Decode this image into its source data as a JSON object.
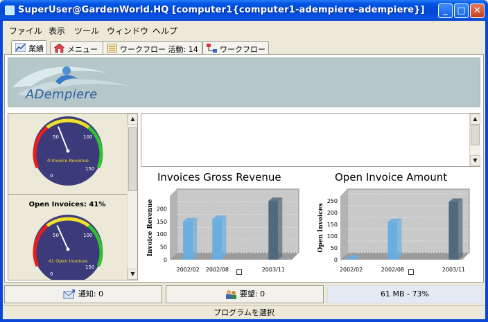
{
  "window": {
    "title": "SuperUser@GardenWorld.HQ  [computer1{computer1-adempiere-adempiere}]",
    "controls": {
      "minimize": "_",
      "maximize": "□",
      "close": "✕"
    }
  },
  "menu": [
    {
      "label": "ファイル"
    },
    {
      "label": "表示"
    },
    {
      "label": "ツール"
    },
    {
      "label": "ウィンドウ"
    },
    {
      "label": "ヘルプ"
    }
  ],
  "tabs": [
    {
      "label": "業績",
      "icon": "chart-icon",
      "active": true
    },
    {
      "label": "メニュー",
      "icon": "home-icon",
      "active": false
    },
    {
      "label": "ワークフロー  活動: 14",
      "icon": "document-icon",
      "active": false
    },
    {
      "label": "ワークフロー",
      "icon": "workflow-icon",
      "active": false
    }
  ],
  "banner": {
    "logo_text": "ADempiere"
  },
  "gauges": {
    "top": {
      "value_label": "0 Invoice Revenue",
      "ticks": [
        "0",
        "50",
        "100",
        "150"
      ],
      "value_fraction": 0.42
    },
    "bottom": {
      "title": "Open Invoices: 41%",
      "value_label": "41 Open Invoices",
      "ticks": [
        "0",
        "50",
        "100",
        "150"
      ],
      "value_fraction": 0.41
    }
  },
  "charts": [
    {
      "title": "Invoices Gross Revenue",
      "ylabel": "Invoice Revenue",
      "yticks": [
        "0",
        "50",
        "100",
        "150",
        "200"
      ],
      "categories": [
        "2002/02",
        "2002/08",
        "2003/11"
      ]
    },
    {
      "title": "Open Invoice Amount",
      "ylabel": "Open Invoices",
      "yticks": [
        "0",
        "50",
        "100",
        "150",
        "200",
        "250"
      ],
      "categories": [
        "2002/02",
        "2002/08",
        "2003/11"
      ]
    }
  ],
  "chart_data": [
    {
      "type": "bar",
      "title": "Invoices Gross Revenue",
      "ylabel": "Invoice Revenue",
      "xlabel": "",
      "categories": [
        "2002/02",
        "2002/08",
        "2003/11"
      ],
      "x_positions": [
        0.12,
        0.36,
        0.82
      ],
      "values": [
        150,
        160,
        230
      ],
      "colors": [
        "#6aaee0",
        "#6aaee0",
        "#51697a"
      ],
      "ylim": [
        0,
        250
      ]
    },
    {
      "type": "bar",
      "title": "Open Invoice Amount",
      "ylabel": "Open Invoices",
      "xlabel": "",
      "categories": [
        "2002/02",
        "2002/08",
        "2003/11"
      ],
      "x_positions": [
        0.06,
        0.4,
        0.9
      ],
      "values": [
        5,
        160,
        245
      ],
      "colors": [
        "#6aaee0",
        "#6aaee0",
        "#51697a"
      ],
      "ylim": [
        0,
        270
      ]
    }
  ],
  "status_buttons": [
    {
      "label": "通知: 0",
      "icon": "notice-icon"
    },
    {
      "label": "要望: 0",
      "icon": "request-icon"
    }
  ],
  "memory": "61 MB - 73%",
  "statusbar": "プログラムを選択"
}
